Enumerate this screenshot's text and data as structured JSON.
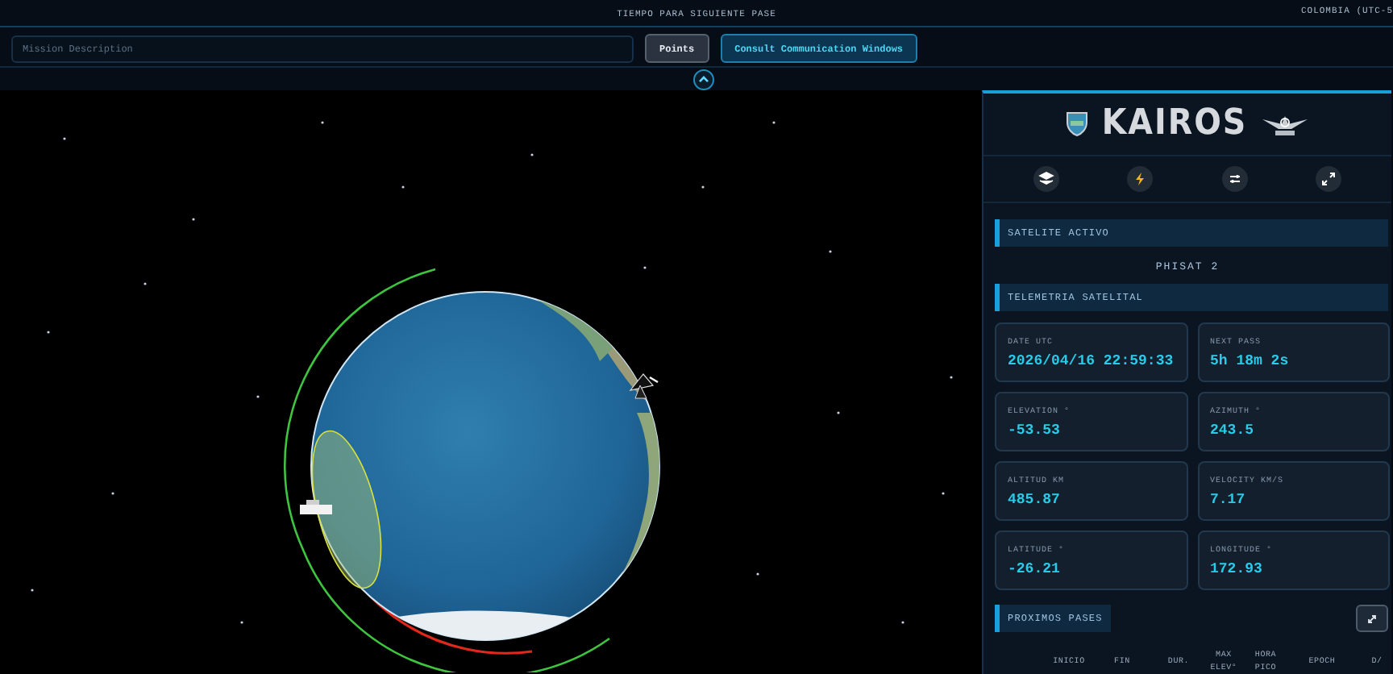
{
  "header": {
    "next_pass_label": "TIEMPO PARA SIGUIENTE PASE",
    "timezone": "COLOMBIA (UTC-5"
  },
  "toolbar": {
    "mission": {
      "placeholder": "Mission Description"
    },
    "buttons": [
      {
        "label": "Points",
        "kind": "plain"
      },
      {
        "label": "Consult Communication Windows",
        "kind": "primary"
      }
    ]
  },
  "panel": {
    "logo": "KAIROS",
    "active_satellite": {
      "title": "SATELITE ACTIVO",
      "name": "PHISAT 2"
    },
    "telemetry": {
      "title": "TELEMETRIA SATELITAL",
      "cards": [
        {
          "label": "DATE UTC",
          "value": "2026/04/16 22:59:33"
        },
        {
          "label": "NEXT PASS",
          "value": "5h 18m 2s"
        },
        {
          "label": "ELEVATION °",
          "value": "-53.53"
        },
        {
          "label": "AZIMUTH °",
          "value": "243.5"
        },
        {
          "label": "ALTITUD KM",
          "value": "485.87"
        },
        {
          "label": "VELOCITY KM/S",
          "value": "7.17"
        },
        {
          "label": "LATITUDE °",
          "value": "-26.21"
        },
        {
          "label": "LONGITUDE °",
          "value": "172.93"
        }
      ]
    },
    "passes": {
      "title": "PROXIMOS PASES",
      "columns": [
        "INICIO",
        "FIN",
        "DUR.",
        "MAX ELEV°",
        "HORA PICO",
        "EPOCH",
        "D/"
      ]
    }
  }
}
